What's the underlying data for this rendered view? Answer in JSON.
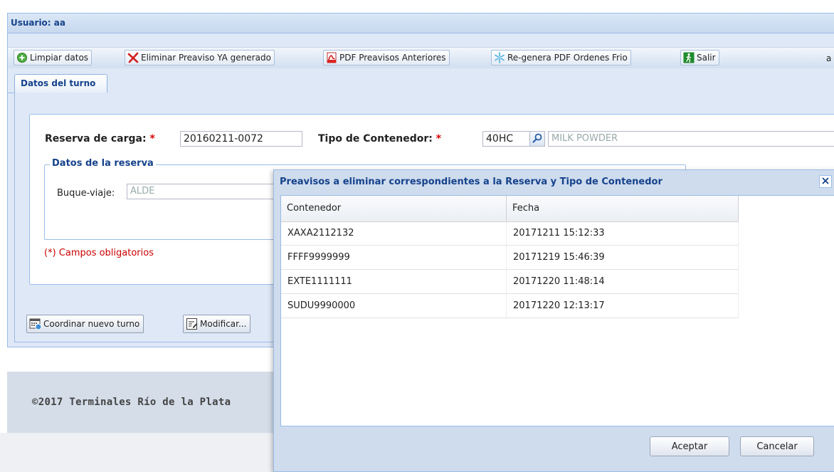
{
  "panel": {
    "title": "Usuario: aa"
  },
  "toolbar": {
    "clear": {
      "label": "Limpiar datos",
      "icon": "add-circle-icon"
    },
    "delete_preaviso": {
      "label": "Eliminar Preaviso YA generado",
      "icon": "delete-x-icon"
    },
    "pdf_previous": {
      "label": "PDF Preavisos Anteriores",
      "icon": "pdf-icon"
    },
    "regen_pdf": {
      "label": "Re-genera PDF Ordenes Frio",
      "icon": "snowflake-icon"
    },
    "exit": {
      "label": "Salir",
      "icon": "exit-icon"
    },
    "extra": "a"
  },
  "tab": {
    "label": "Datos del turno"
  },
  "form": {
    "reserva_label": "Reserva de carga:",
    "reserva_value": "20160211-0072",
    "tipo_label": "Tipo de Contenedor:",
    "tipo_value": "40HC",
    "commodity_value": "MILK POWDER",
    "required_mark": "*",
    "fieldset_legend": "Datos de la reserva",
    "buque_label": "Buque-viaje:",
    "buque_value": "ALDE",
    "obligatorios": "(*) Campos obligatorios"
  },
  "actions": {
    "coordinar": "Coordinar nuevo turno",
    "modificar": "Modificar..."
  },
  "footer": {
    "text": "©2017 Terminales Río de la Plata"
  },
  "modal": {
    "title": "Preavisos a eliminar correspondientes a la Reserva y Tipo de Contenedor",
    "columns": [
      "Contenedor",
      "Fecha"
    ],
    "rows": [
      {
        "contenedor": "XAXA2112132",
        "fecha": "20171211 15:12:33"
      },
      {
        "contenedor": "FFFF9999999",
        "fecha": "20171219 15:46:39"
      },
      {
        "contenedor": "EXTE1111111",
        "fecha": "20171220 11:48:14"
      },
      {
        "contenedor": "SUDU9990000",
        "fecha": "20171220 12:13:17"
      }
    ],
    "accept": "Aceptar",
    "cancel": "Cancelar"
  },
  "colors": {
    "header_text": "#15428b",
    "panel_bg": "#dfe8f6",
    "border": "#99bbe8",
    "required": "#cc0000"
  }
}
